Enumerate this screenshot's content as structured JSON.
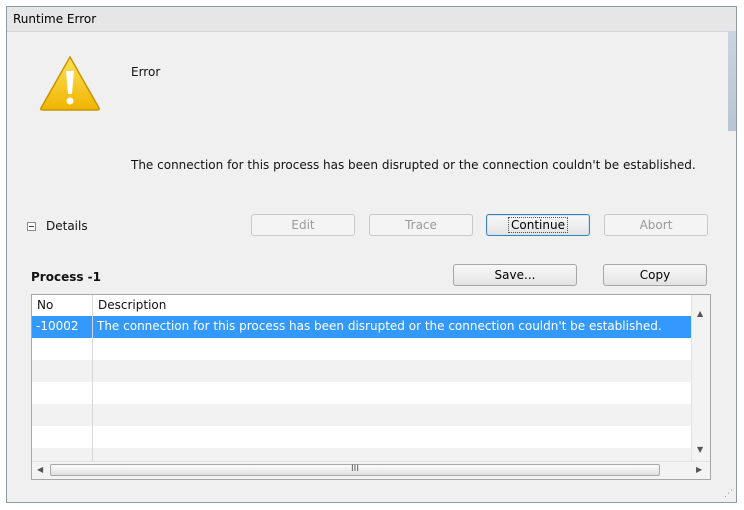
{
  "window": {
    "title": "Runtime Error"
  },
  "icon": {
    "name": "warning-icon",
    "color": "#f5c400"
  },
  "dialog": {
    "error_label": "Error",
    "message": "The connection for this process has been disrupted or the connection couldn't be established.",
    "details_label": "Details"
  },
  "buttons": {
    "edit": "Edit",
    "trace": "Trace",
    "continue": "Continue",
    "abort": "Abort",
    "save": "Save...",
    "copy": "Copy"
  },
  "process": {
    "label": "Process -1"
  },
  "table": {
    "columns": [
      "No",
      "Description"
    ],
    "rows": [
      {
        "no": "-10002",
        "description": "The connection for this process has been disrupted or the connection couldn't be established.",
        "selected": true
      }
    ]
  },
  "scrollbar": {
    "thumb_grip": "III"
  },
  "colors": {
    "selection": "#3399ff",
    "window_bg": "#f0f0f0"
  }
}
